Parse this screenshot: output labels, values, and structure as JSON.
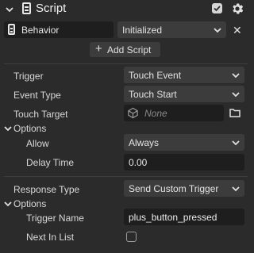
{
  "header": {
    "title": "Script",
    "enabled": true,
    "icons": [
      "chevron-down-icon",
      "script-icon",
      "checkbox-icon",
      "gear-icon"
    ]
  },
  "behavior_row": {
    "name_value": "Behavior",
    "state_value": "Initialized",
    "remove_icon": "close-icon",
    "remove_label": "✕"
  },
  "add_script_label": "Add Script",
  "fields": {
    "trigger": {
      "label": "Trigger",
      "value": "Touch Event"
    },
    "event_type": {
      "label": "Event Type",
      "value": "Touch Start"
    },
    "touch_target": {
      "label": "Touch Target",
      "value": "None"
    },
    "options_1": {
      "label": "Options"
    },
    "allow": {
      "label": "Allow",
      "value": "Always"
    },
    "delay_time": {
      "label": "Delay Time",
      "value": "0.00"
    },
    "response_type": {
      "label": "Response Type",
      "value": "Send Custom Trigger"
    },
    "options_2": {
      "label": "Options"
    },
    "trigger_name": {
      "label": "Trigger Name",
      "value": "plus_button_pressed"
    },
    "next_in_list": {
      "label": "Next In List",
      "checked": false
    }
  },
  "colors": {
    "background": "#2b2b2b",
    "field_dark": "#1e1e1e",
    "select_bg": "#3c3c3c",
    "text": "#dcdcdc"
  }
}
